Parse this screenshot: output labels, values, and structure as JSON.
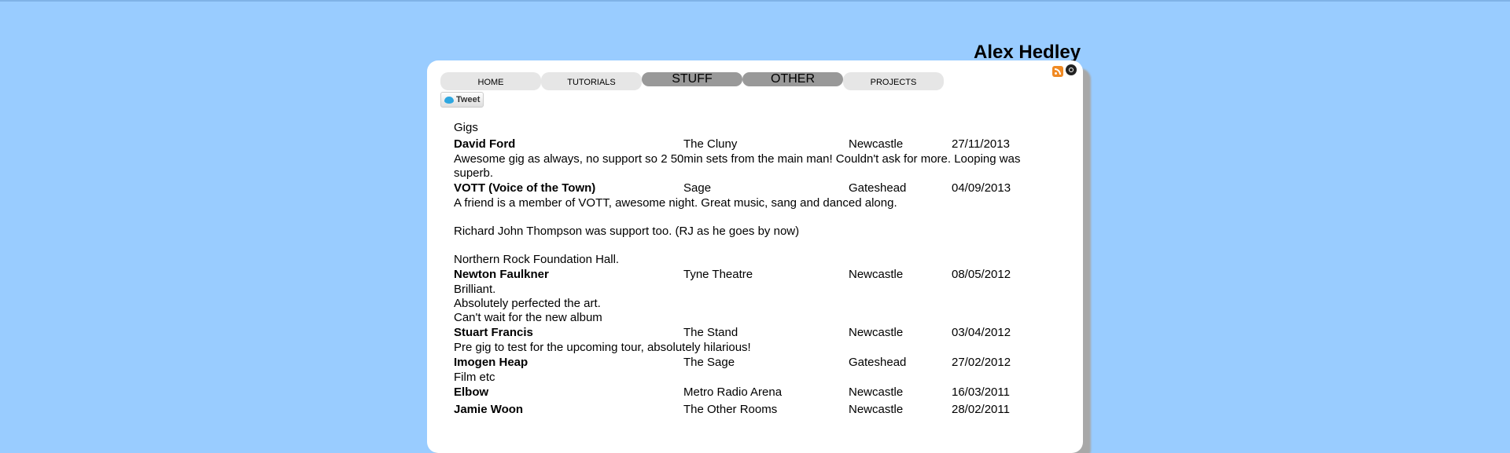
{
  "site": {
    "title": "Alex Hedley"
  },
  "icons": {
    "feed_1": "rss-icon",
    "feed_2": "disc-icon"
  },
  "nav": {
    "tabs": [
      {
        "label": "HOME",
        "active": false
      },
      {
        "label": "TUTORIALS",
        "active": false
      },
      {
        "label": "STUFF",
        "active": true
      },
      {
        "label": "OTHER",
        "active": true
      },
      {
        "label": "PROJECTS",
        "active": false
      }
    ]
  },
  "tweet_button": {
    "label": "Tweet"
  },
  "content": {
    "section_title": "Gigs",
    "gigs": [
      {
        "artist": "David Ford",
        "venue": "The Cluny",
        "city": "Newcastle",
        "date": "27/11/2013",
        "notes": [
          "Awesome gig as always, no support so 2 50min sets from the main man! Couldn't ask for more. Looping was superb."
        ]
      },
      {
        "artist": "VOTT (Voice of the Town)",
        "venue": "Sage",
        "city": "Gateshead",
        "date": "04/09/2013",
        "notes": [
          "A friend is a member of VOTT, awesome night. Great music, sang and danced along.",
          "Richard John Thompson was support too. (RJ as he goes by now)",
          "Northern Rock Foundation Hall."
        ]
      },
      {
        "artist": "Newton Faulkner",
        "venue": "Tyne Theatre",
        "city": "Newcastle",
        "date": "08/05/2012",
        "notes": [
          "Brilliant.",
          "Absolutely perfected the art.",
          "Can't wait for the new album"
        ]
      },
      {
        "artist": "Stuart Francis",
        "venue": "The Stand",
        "city": "Newcastle",
        "date": "03/04/2012",
        "notes": [
          "Pre gig to test for the upcoming tour, absolutely hilarious!"
        ]
      },
      {
        "artist": "Imogen Heap",
        "venue": "The Sage",
        "city": "Gateshead",
        "date": "27/02/2012",
        "notes": [
          "Film etc"
        ]
      },
      {
        "artist": "Elbow",
        "venue": "Metro Radio Arena",
        "city": "Newcastle",
        "date": "16/03/2011",
        "notes": []
      },
      {
        "artist": "Jamie Woon",
        "venue": "The Other Rooms",
        "city": "Newcastle",
        "date": "28/02/2011",
        "notes": []
      }
    ]
  }
}
